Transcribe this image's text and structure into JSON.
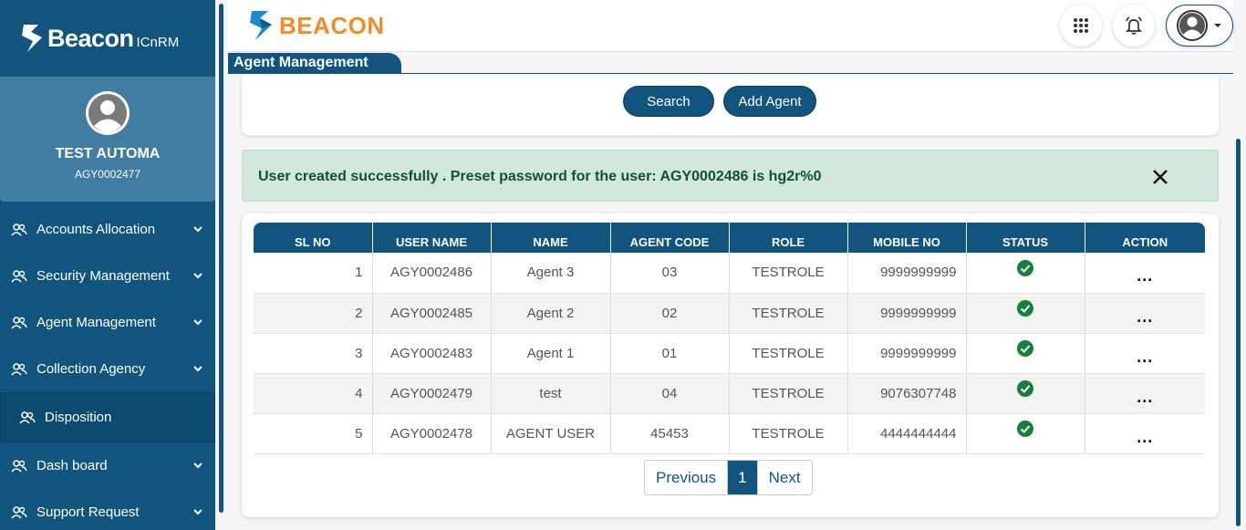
{
  "sidebar": {
    "brand_name": "Beacon",
    "brand_sub": "ICnRM",
    "user_name": "TEST AUTOMA",
    "user_code": "AGY0002477",
    "items": [
      {
        "label": "Accounts Allocation"
      },
      {
        "label": "Security Management"
      },
      {
        "label": "Agent Management"
      },
      {
        "label": "Collection Agency"
      },
      {
        "label": "Disposition"
      },
      {
        "label": "Dash board"
      },
      {
        "label": "Support Request"
      }
    ]
  },
  "header": {
    "logo_text": "BEACON",
    "section_title": "Agent Management",
    "icons": [
      "apps-grid-icon",
      "bell-icon",
      "user-avatar-icon"
    ]
  },
  "actions": {
    "search_label": "Search",
    "add_agent_label": "Add Agent"
  },
  "alert": {
    "message": "User created successfully . Preset password for the user: AGY0002486 is hg2r%0"
  },
  "table": {
    "headers": [
      "SL NO",
      "USER NAME",
      "NAME",
      "AGENT CODE",
      "ROLE",
      "MOBILE NO",
      "STATUS",
      "ACTION"
    ],
    "rows": [
      {
        "sl": "1",
        "user": "AGY0002486",
        "name": "Agent 3",
        "code": "03",
        "role": "TESTROLE",
        "mobile": "9999999999",
        "status": "active",
        "action": "..."
      },
      {
        "sl": "2",
        "user": "AGY0002485",
        "name": "Agent 2",
        "code": "02",
        "role": "TESTROLE",
        "mobile": "9999999999",
        "status": "active",
        "action": "..."
      },
      {
        "sl": "3",
        "user": "AGY0002483",
        "name": "Agent 1",
        "code": "01",
        "role": "TESTROLE",
        "mobile": "9999999999",
        "status": "active",
        "action": "..."
      },
      {
        "sl": "4",
        "user": "AGY0002479",
        "name": "test",
        "code": "04",
        "role": "TESTROLE",
        "mobile": "9076307748",
        "status": "active",
        "action": "..."
      },
      {
        "sl": "5",
        "user": "AGY0002478",
        "name": "AGENT USER",
        "code": "45453",
        "role": "TESTROLE",
        "mobile": "4444444444",
        "status": "active",
        "action": "..."
      }
    ]
  },
  "pagination": {
    "previous": "Previous",
    "current": "1",
    "next": "Next"
  },
  "colors": {
    "primary": "#11557f",
    "profile_bg": "#417ca2",
    "accent_orange": "#f28c28",
    "success_bg": "#d2e8dc",
    "success_text": "#0f5132",
    "status_green": "#15803d"
  }
}
